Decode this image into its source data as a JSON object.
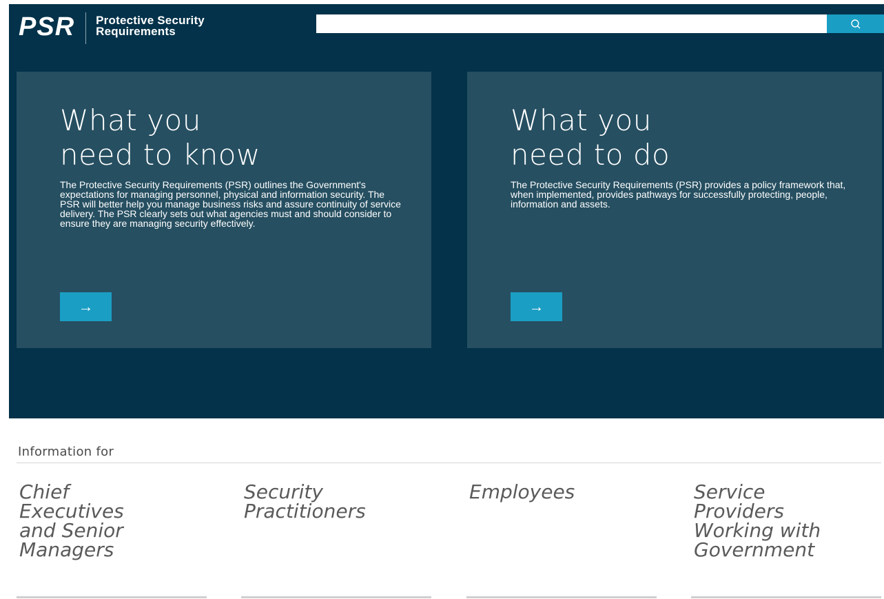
{
  "logo": {
    "mark": "PSR",
    "title_line1": "Protective Security",
    "title_line2": "Requirements"
  },
  "search": {
    "placeholder": "",
    "value": "",
    "icon": "search-icon"
  },
  "cards": [
    {
      "title_line1": "What you",
      "title_line2": "need to know",
      "body": "The Protective Security Requirements (PSR) outlines the Government's expectations for managing personnel, physical and information security. The PSR will better help you manage business risks and assure continuity of service delivery. The PSR clearly sets out what agencies must and should consider to ensure they are managing security effectively.",
      "arrow": "→"
    },
    {
      "title_line1": "What you",
      "title_line2": "need to do",
      "body": "The Protective Security Requirements (PSR) provides a policy framework that, when implemented, provides pathways for successfully protecting, people, information and assets.",
      "arrow": "→"
    }
  ],
  "info": {
    "heading": "Information for",
    "audiences": [
      {
        "lines": [
          "Chief",
          "Executives",
          "and Senior",
          "Managers"
        ]
      },
      {
        "lines": [
          "Security",
          "Practitioners"
        ]
      },
      {
        "lines": [
          "Employees"
        ]
      },
      {
        "lines": [
          "Service",
          "Providers",
          "Working with",
          "Government"
        ]
      }
    ]
  },
  "colors": {
    "hero_bg": "#03324a",
    "card_bg": "#264f61",
    "accent": "#1b9ec4"
  }
}
